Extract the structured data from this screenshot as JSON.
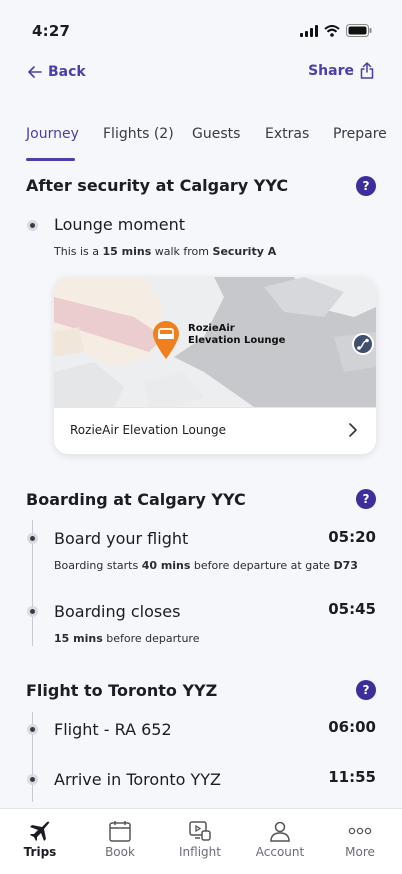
{
  "status": {
    "time": "4:27"
  },
  "nav": {
    "back_label": "Back",
    "share_label": "Share"
  },
  "tabs": [
    {
      "label": "Journey"
    },
    {
      "label": "Flights (2)"
    },
    {
      "label": "Guests"
    },
    {
      "label": "Extras"
    },
    {
      "label": "Prepare"
    }
  ],
  "sections": {
    "security": {
      "title": "After security at Calgary YYC",
      "help": "?",
      "lounge": {
        "title": "Lounge moment",
        "sub_prefix": "This is a ",
        "sub_bold1": "15 mins",
        "sub_mid": " walk from ",
        "sub_bold2": "Security A",
        "map_pin_label_line1": "RozieAir",
        "map_pin_label_line2": "Elevation Lounge",
        "card_label": "RozieAir Elevation Lounge"
      }
    },
    "boarding": {
      "title": "Boarding at Calgary YYC",
      "help": "?",
      "board": {
        "title": "Board your flight",
        "time": "05:20",
        "sub_prefix": "Boarding starts ",
        "sub_bold1": "40 mins",
        "sub_mid": " before departure at gate ",
        "sub_bold2": "D73"
      },
      "closes": {
        "title": "Boarding closes",
        "time": "05:45",
        "sub_bold1": "15 mins",
        "sub_mid": " before departure"
      }
    },
    "flight": {
      "title": "Flight to Toronto YYZ",
      "help": "?",
      "flight_item": {
        "title": "Flight - RA 652",
        "time": "06:00"
      },
      "arrive_item": {
        "title": "Arrive in Toronto YYZ",
        "time": "11:55"
      }
    }
  },
  "bottom_nav": [
    {
      "label": "Trips",
      "icon": "plane-icon"
    },
    {
      "label": "Book",
      "icon": "calendar-icon"
    },
    {
      "label": "Inflight",
      "icon": "inflight-icon"
    },
    {
      "label": "Account",
      "icon": "person-icon"
    },
    {
      "label": "More",
      "icon": "more-icon"
    }
  ],
  "colors": {
    "accent": "#4b3fa8",
    "help_bg": "#3c2f9c",
    "pin": "#f07f1e"
  }
}
